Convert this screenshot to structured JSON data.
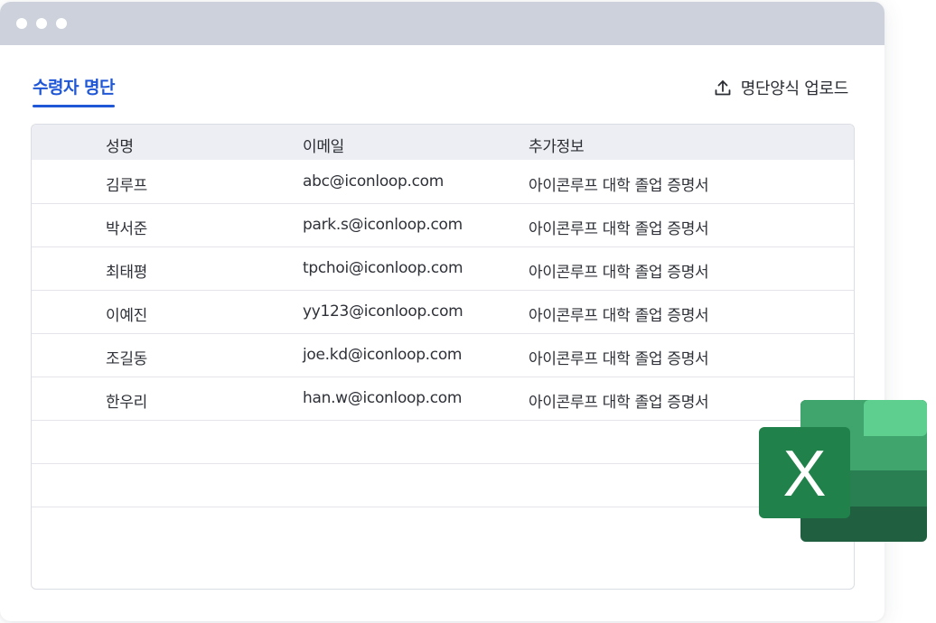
{
  "window": {
    "controls": [
      "dot-1",
      "dot-2",
      "dot-3"
    ]
  },
  "tab": {
    "label": "수령자 명단"
  },
  "upload": {
    "label": "명단양식 업로드",
    "icon": "upload-icon"
  },
  "table": {
    "headers": [
      "성명",
      "이메일",
      "추가정보"
    ],
    "rows": [
      [
        "김루프",
        "abc@iconloop.com",
        "아이콘루프 대학 졸업 증명서"
      ],
      [
        "박서준",
        "park.s@iconloop.com",
        "아이콘루프 대학 졸업 증명서"
      ],
      [
        "최태평",
        "tpchoi@iconloop.com",
        "아이콘루프 대학 졸업 증명서"
      ],
      [
        "이예진",
        "yy123@iconloop.com",
        "아이콘루프 대학 졸업 증명서"
      ],
      [
        "조길동",
        "joe.kd@iconloop.com",
        "아이콘루프 대학 졸업 증명서"
      ],
      [
        "한우리",
        "han.w@iconloop.com",
        "아이콘루프 대학 졸업 증명서"
      ]
    ],
    "empty_rows": 2
  },
  "excel_icon": {
    "letter": "X",
    "icon": "excel-icon",
    "colors": {
      "light": "#5fcf8f",
      "mid": "#3fa56d",
      "dark": "#2a7f52",
      "darkest": "#205f40",
      "badge": "#21814b"
    }
  },
  "colors": {
    "accent": "#1f57d6",
    "titlebar": "#ccd1dc",
    "header_bg": "#eceef3"
  }
}
